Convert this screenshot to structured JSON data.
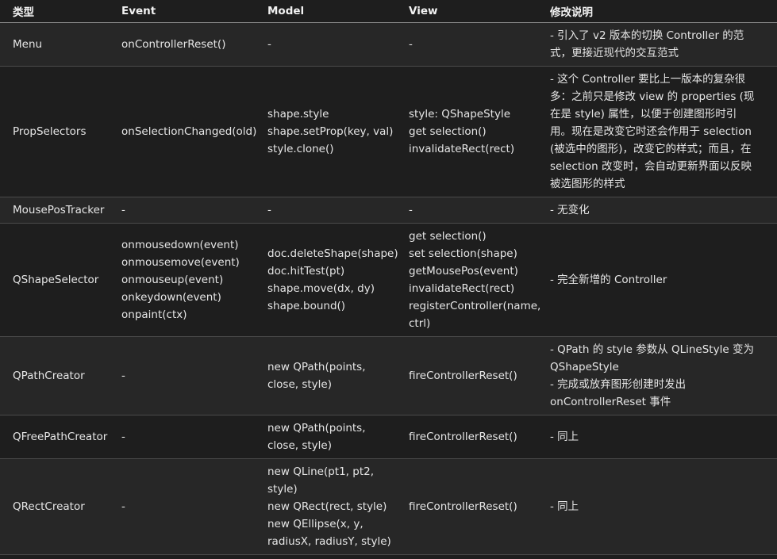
{
  "headers": [
    "类型",
    "Event",
    "Model",
    "View",
    "修改说明"
  ],
  "rows": [
    {
      "type": "Menu",
      "event": [
        "onControllerReset()"
      ],
      "model": [
        "-"
      ],
      "view": [
        "-"
      ],
      "note": [
        "- 引入了 v2 版本的切换 Controller 的范",
        "式，更接近现代的交互范式"
      ]
    },
    {
      "type": "PropSelectors",
      "event": [
        "onSelectionChanged(old)"
      ],
      "model": [
        "shape.style",
        "shape.setProp(key, val)",
        "style.clone()"
      ],
      "view": [
        "style: QShapeStyle",
        "get selection()",
        "invalidateRect(rect)"
      ],
      "note": [
        "- 这个 Controller 要比上一版本的复杂很",
        "多：之前只是修改 view 的 properties (现",
        "在是 style) 属性，以便于创建图形时引",
        "用。现在是改变它时还会作用于 selection",
        "(被选中的图形)，改变它的样式；而且，在",
        "selection 改变时，会自动更新界面以反映",
        "被选图形的样式"
      ]
    },
    {
      "type": "MousePosTracker",
      "event": [
        "-"
      ],
      "model": [
        "-"
      ],
      "view": [
        "-"
      ],
      "note": [
        "- 无变化"
      ]
    },
    {
      "type": "QShapeSelector",
      "event": [
        "onmousedown(event)",
        "onmousemove(event)",
        "onmouseup(event)",
        "onkeydown(event)",
        "onpaint(ctx)"
      ],
      "model": [
        "doc.deleteShape(shape)",
        "doc.hitTest(pt)",
        "shape.move(dx, dy)",
        "shape.bound()"
      ],
      "view": [
        "get selection()",
        "set selection(shape)",
        "getMousePos(event)",
        "invalidateRect(rect)",
        "registerController(name,",
        "ctrl)"
      ],
      "note": [
        "- 完全新增的 Controller"
      ]
    },
    {
      "type": "QPathCreator",
      "event": [
        "-"
      ],
      "model": [
        "new QPath(points,",
        "close, style)"
      ],
      "view": [
        "fireControllerReset()"
      ],
      "note": [
        "- QPath 的 style 参数从 QLineStyle 变为",
        "QShapeStyle",
        "- 完成或放弃图形创建时发出",
        "onControllerReset 事件"
      ]
    },
    {
      "type": "QFreePathCreator",
      "event": [
        "-"
      ],
      "model": [
        "new QPath(points,",
        "close, style)"
      ],
      "view": [
        "fireControllerReset()"
      ],
      "note": [
        "- 同上"
      ]
    },
    {
      "type": "QRectCreator",
      "event": [
        "-"
      ],
      "model": [
        "new QLine(pt1, pt2,",
        "style)",
        "new QRect(rect, style)",
        "new QEllipse(x, y,",
        "radiusX, radiusY, style)"
      ],
      "view": [
        "fireControllerReset()"
      ],
      "note": [
        "- 同上"
      ]
    }
  ]
}
